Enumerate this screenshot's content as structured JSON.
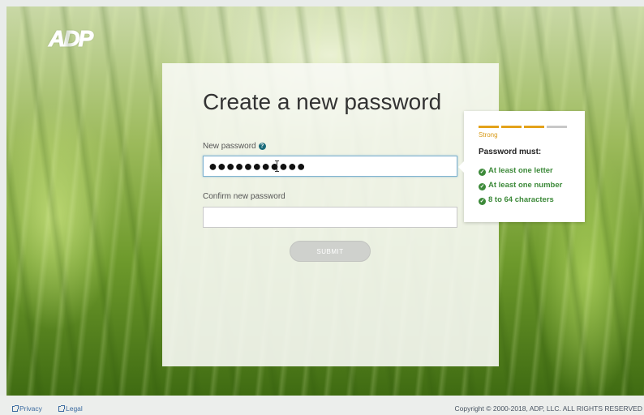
{
  "brand": {
    "logo_text": "ADP"
  },
  "card": {
    "title": "Create a new password",
    "new_password_label": "New password",
    "new_password_value": "●●●●●●●●●●●",
    "confirm_label": "Confirm new password",
    "confirm_value": "",
    "submit_label": "SUBMIT"
  },
  "popover": {
    "strength_label": "Strength: Strong",
    "strength_text": "Strong",
    "strength_level": 0.75,
    "must_label": "Password must:",
    "rules": [
      "At least one letter",
      "At least one number",
      "8 to 64 characters"
    ]
  },
  "footer": {
    "privacy": "Privacy",
    "legal": "Legal",
    "copyright": "Copyright © 2000-2018, ADP, LLC. ALL RIGHTS RESERVED"
  },
  "colors": {
    "strength_on": "#e3a21a",
    "strength_off": "#c8c8c8",
    "rule_ok": "#3d8a3a",
    "link": "#3a6aa0"
  },
  "icons": [
    "help-icon",
    "check-icon",
    "external-link-icon"
  ]
}
